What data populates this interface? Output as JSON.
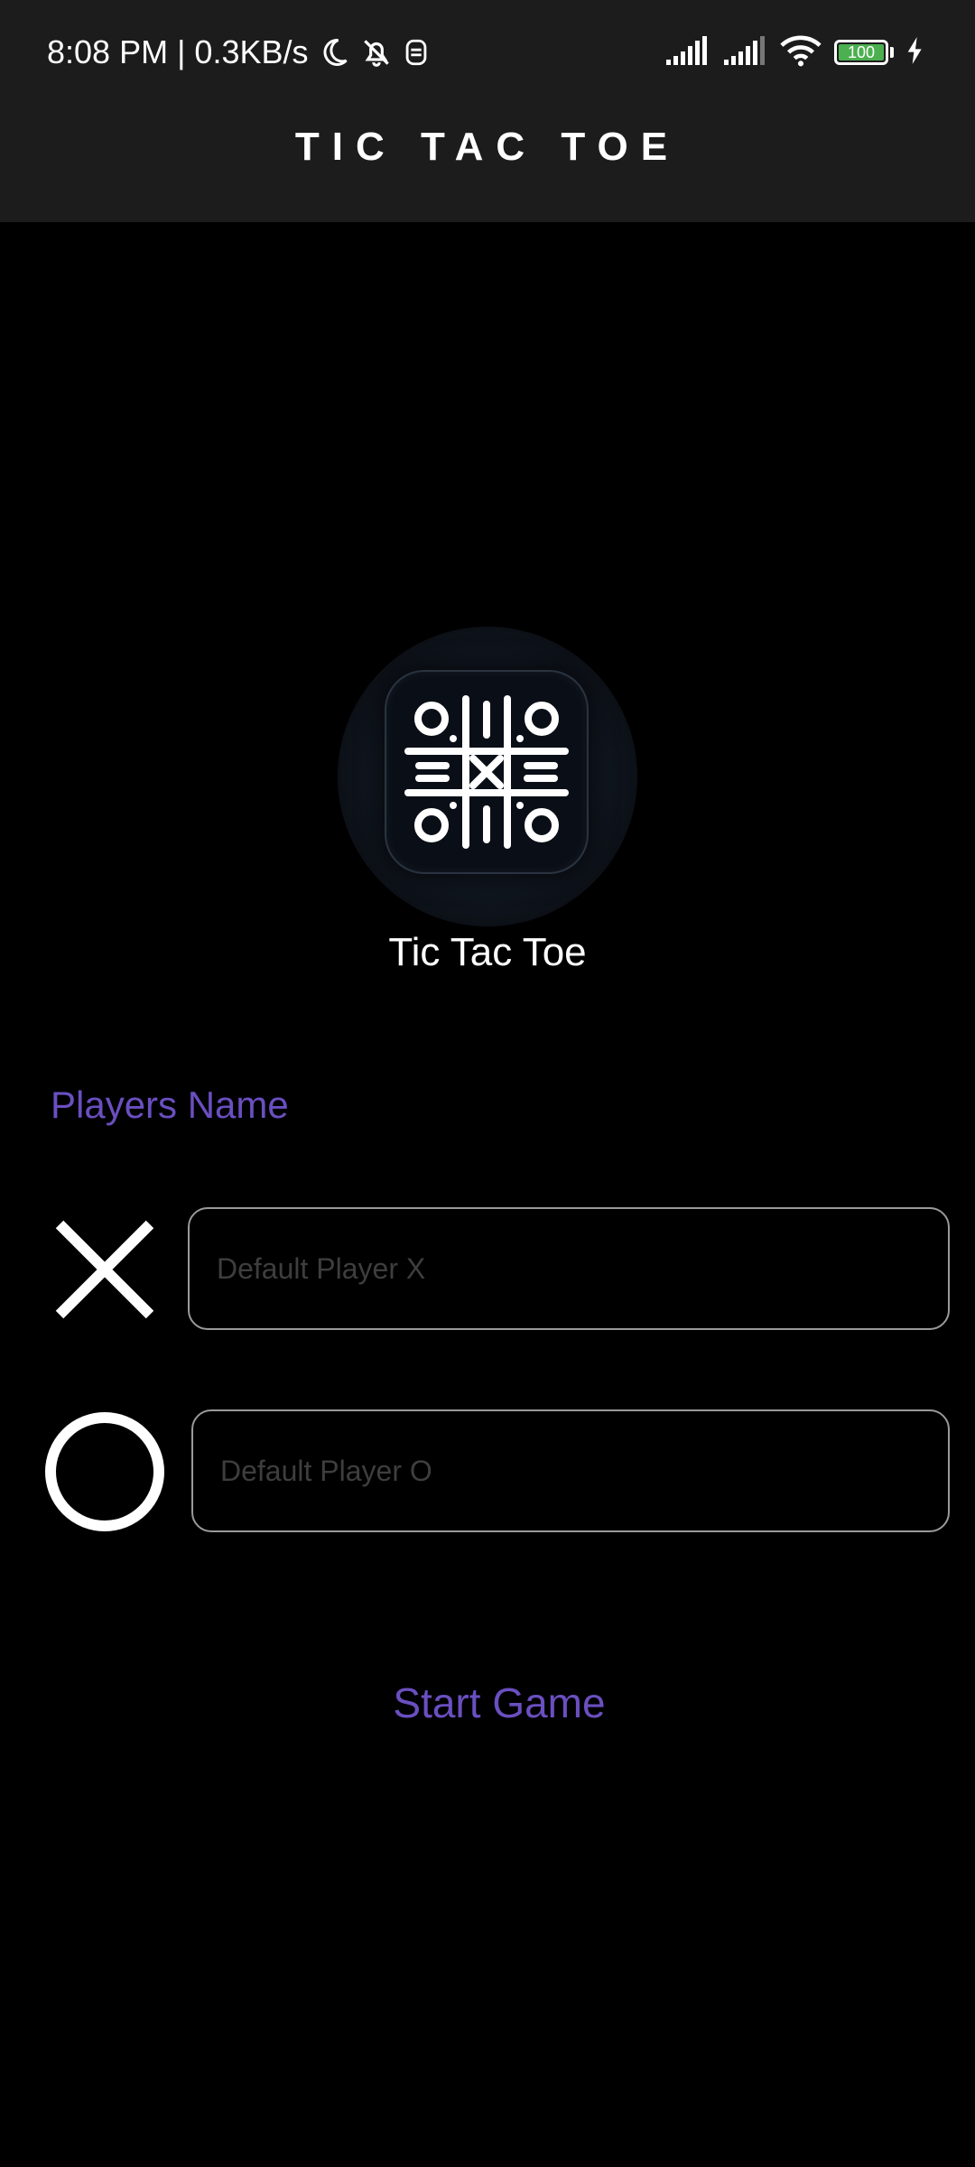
{
  "status_bar": {
    "time_speed": "8:08 PM | 0.3KB/s",
    "icons": [
      "moon-icon",
      "bell-off-icon",
      "notification-icon",
      "signal-icon",
      "signal-icon",
      "wifi-icon",
      "battery-icon",
      "charging-icon"
    ],
    "battery_level": "100",
    "battery_color": "#4caf50"
  },
  "app_bar": {
    "title": "TIC TAC TOE"
  },
  "logo": {
    "icon": "tic-tac-toe-board-icon",
    "name": "Tic Tac Toe"
  },
  "players": {
    "section_label": "Players Name",
    "player_x": {
      "icon": "x-mark-icon",
      "value": "",
      "placeholder": "Default Player X"
    },
    "player_o": {
      "icon": "o-mark-icon",
      "value": "",
      "placeholder": "Default Player O"
    }
  },
  "actions": {
    "start_label": "Start Game"
  },
  "colors": {
    "accent": "#6a4fc0",
    "header_background": "#1c1c1c",
    "background": "#000000",
    "input_border": "#9a9a9a"
  }
}
